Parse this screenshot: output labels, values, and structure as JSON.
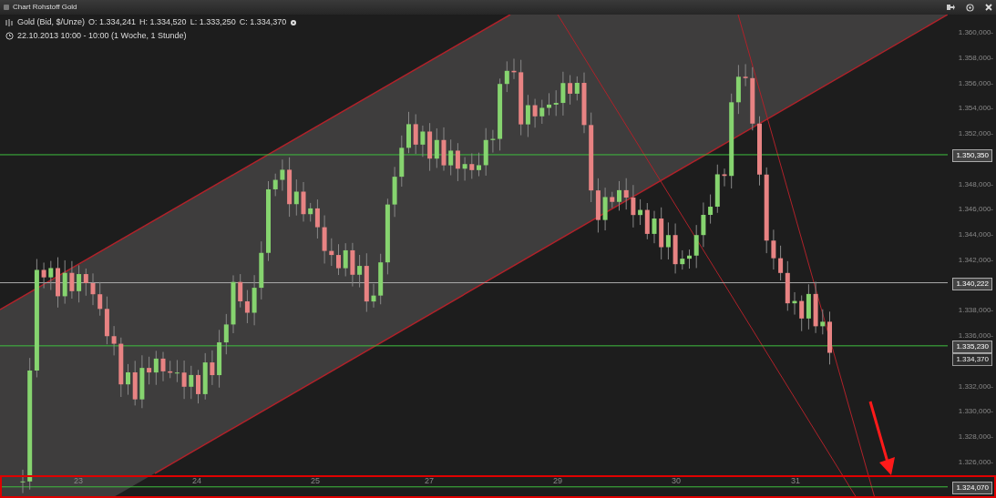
{
  "window": {
    "title": "Chart Rohstoff Gold"
  },
  "header": {
    "instrument": "Gold (Bid, $/Unze)",
    "ohlc": [
      "O: 1.334,241",
      "H: 1.334,520",
      "L: 1.333,250",
      "C: 1.334,370"
    ],
    "period": "22.10.2013 10:00 - 10:00 (1 Woche, 1 Stunde)"
  },
  "y_axis": [
    "1.360,000-",
    "1.358,000-",
    "1.356,000-",
    "1.354,000-",
    "1.352,000-",
    "1.348,000-",
    "1.346,000-",
    "1.344,000-",
    "1.342,000-",
    "1.338,000-",
    "1.336,000-",
    "1.332,000-",
    "1.330,000-",
    "1.328,000-",
    "1.326,000-"
  ],
  "price_tags": [
    {
      "label": "1.350,350",
      "kind": "level"
    },
    {
      "label": "1.340,222",
      "kind": "level"
    },
    {
      "label": "1.335,230",
      "kind": "level"
    },
    {
      "label": "1.334,370",
      "kind": "last"
    },
    {
      "label": "1.324,070",
      "kind": "level"
    }
  ],
  "x_axis": [
    "23",
    "24",
    "25",
    "27",
    "29",
    "30",
    "31"
  ]
}
